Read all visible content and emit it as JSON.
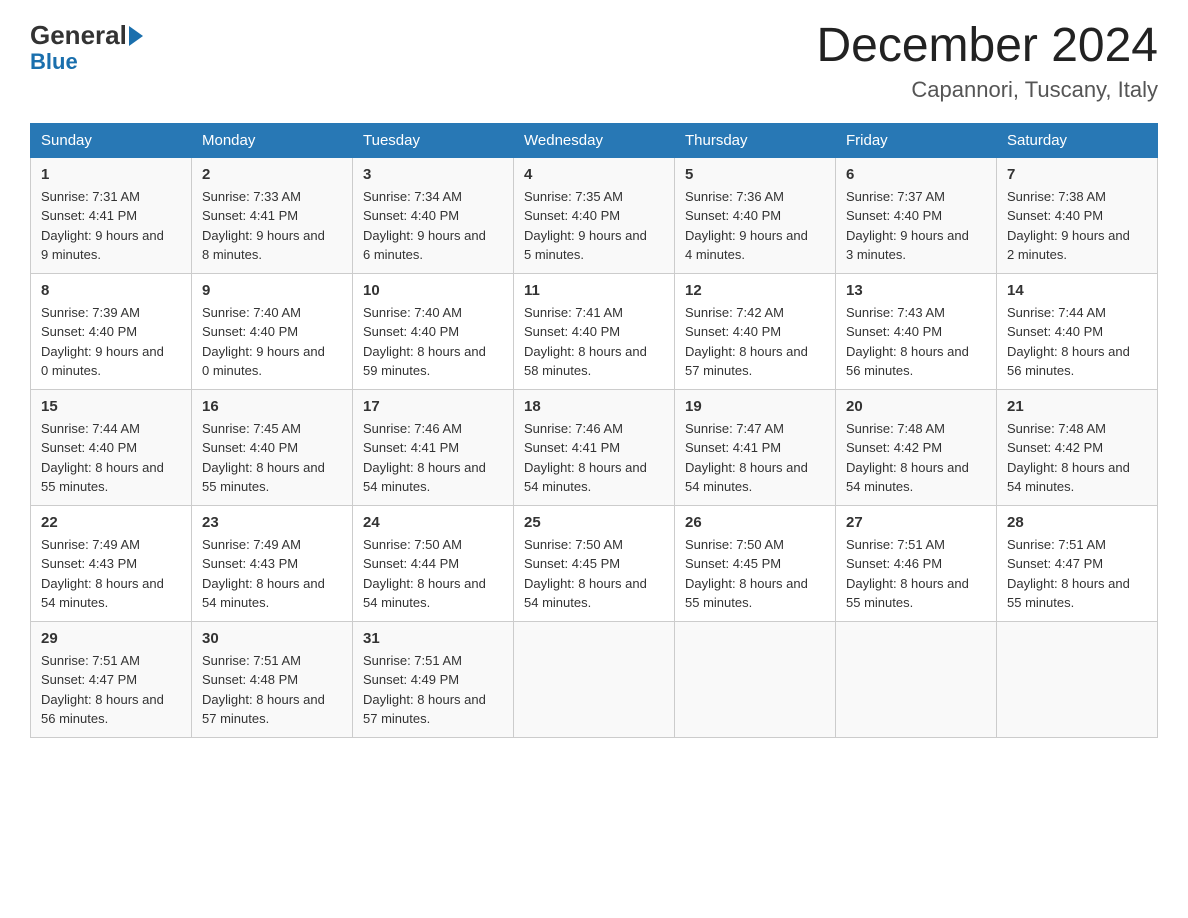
{
  "logo": {
    "general": "General",
    "arrow": "▶",
    "blue": "Blue"
  },
  "header": {
    "month": "December 2024",
    "location": "Capannori, Tuscany, Italy"
  },
  "days_of_week": [
    "Sunday",
    "Monday",
    "Tuesday",
    "Wednesday",
    "Thursday",
    "Friday",
    "Saturday"
  ],
  "weeks": [
    [
      {
        "day": "1",
        "sunrise": "7:31 AM",
        "sunset": "4:41 PM",
        "daylight": "9 hours and 9 minutes."
      },
      {
        "day": "2",
        "sunrise": "7:33 AM",
        "sunset": "4:41 PM",
        "daylight": "9 hours and 8 minutes."
      },
      {
        "day": "3",
        "sunrise": "7:34 AM",
        "sunset": "4:40 PM",
        "daylight": "9 hours and 6 minutes."
      },
      {
        "day": "4",
        "sunrise": "7:35 AM",
        "sunset": "4:40 PM",
        "daylight": "9 hours and 5 minutes."
      },
      {
        "day": "5",
        "sunrise": "7:36 AM",
        "sunset": "4:40 PM",
        "daylight": "9 hours and 4 minutes."
      },
      {
        "day": "6",
        "sunrise": "7:37 AM",
        "sunset": "4:40 PM",
        "daylight": "9 hours and 3 minutes."
      },
      {
        "day": "7",
        "sunrise": "7:38 AM",
        "sunset": "4:40 PM",
        "daylight": "9 hours and 2 minutes."
      }
    ],
    [
      {
        "day": "8",
        "sunrise": "7:39 AM",
        "sunset": "4:40 PM",
        "daylight": "9 hours and 0 minutes."
      },
      {
        "day": "9",
        "sunrise": "7:40 AM",
        "sunset": "4:40 PM",
        "daylight": "9 hours and 0 minutes."
      },
      {
        "day": "10",
        "sunrise": "7:40 AM",
        "sunset": "4:40 PM",
        "daylight": "8 hours and 59 minutes."
      },
      {
        "day": "11",
        "sunrise": "7:41 AM",
        "sunset": "4:40 PM",
        "daylight": "8 hours and 58 minutes."
      },
      {
        "day": "12",
        "sunrise": "7:42 AM",
        "sunset": "4:40 PM",
        "daylight": "8 hours and 57 minutes."
      },
      {
        "day": "13",
        "sunrise": "7:43 AM",
        "sunset": "4:40 PM",
        "daylight": "8 hours and 56 minutes."
      },
      {
        "day": "14",
        "sunrise": "7:44 AM",
        "sunset": "4:40 PM",
        "daylight": "8 hours and 56 minutes."
      }
    ],
    [
      {
        "day": "15",
        "sunrise": "7:44 AM",
        "sunset": "4:40 PM",
        "daylight": "8 hours and 55 minutes."
      },
      {
        "day": "16",
        "sunrise": "7:45 AM",
        "sunset": "4:40 PM",
        "daylight": "8 hours and 55 minutes."
      },
      {
        "day": "17",
        "sunrise": "7:46 AM",
        "sunset": "4:41 PM",
        "daylight": "8 hours and 54 minutes."
      },
      {
        "day": "18",
        "sunrise": "7:46 AM",
        "sunset": "4:41 PM",
        "daylight": "8 hours and 54 minutes."
      },
      {
        "day": "19",
        "sunrise": "7:47 AM",
        "sunset": "4:41 PM",
        "daylight": "8 hours and 54 minutes."
      },
      {
        "day": "20",
        "sunrise": "7:48 AM",
        "sunset": "4:42 PM",
        "daylight": "8 hours and 54 minutes."
      },
      {
        "day": "21",
        "sunrise": "7:48 AM",
        "sunset": "4:42 PM",
        "daylight": "8 hours and 54 minutes."
      }
    ],
    [
      {
        "day": "22",
        "sunrise": "7:49 AM",
        "sunset": "4:43 PM",
        "daylight": "8 hours and 54 minutes."
      },
      {
        "day": "23",
        "sunrise": "7:49 AM",
        "sunset": "4:43 PM",
        "daylight": "8 hours and 54 minutes."
      },
      {
        "day": "24",
        "sunrise": "7:50 AM",
        "sunset": "4:44 PM",
        "daylight": "8 hours and 54 minutes."
      },
      {
        "day": "25",
        "sunrise": "7:50 AM",
        "sunset": "4:45 PM",
        "daylight": "8 hours and 54 minutes."
      },
      {
        "day": "26",
        "sunrise": "7:50 AM",
        "sunset": "4:45 PM",
        "daylight": "8 hours and 55 minutes."
      },
      {
        "day": "27",
        "sunrise": "7:51 AM",
        "sunset": "4:46 PM",
        "daylight": "8 hours and 55 minutes."
      },
      {
        "day": "28",
        "sunrise": "7:51 AM",
        "sunset": "4:47 PM",
        "daylight": "8 hours and 55 minutes."
      }
    ],
    [
      {
        "day": "29",
        "sunrise": "7:51 AM",
        "sunset": "4:47 PM",
        "daylight": "8 hours and 56 minutes."
      },
      {
        "day": "30",
        "sunrise": "7:51 AM",
        "sunset": "4:48 PM",
        "daylight": "8 hours and 57 minutes."
      },
      {
        "day": "31",
        "sunrise": "7:51 AM",
        "sunset": "4:49 PM",
        "daylight": "8 hours and 57 minutes."
      },
      {
        "day": "",
        "sunrise": "",
        "sunset": "",
        "daylight": ""
      },
      {
        "day": "",
        "sunrise": "",
        "sunset": "",
        "daylight": ""
      },
      {
        "day": "",
        "sunrise": "",
        "sunset": "",
        "daylight": ""
      },
      {
        "day": "",
        "sunrise": "",
        "sunset": "",
        "daylight": ""
      }
    ]
  ],
  "labels": {
    "sunrise": "Sunrise:",
    "sunset": "Sunset:",
    "daylight": "Daylight:"
  }
}
